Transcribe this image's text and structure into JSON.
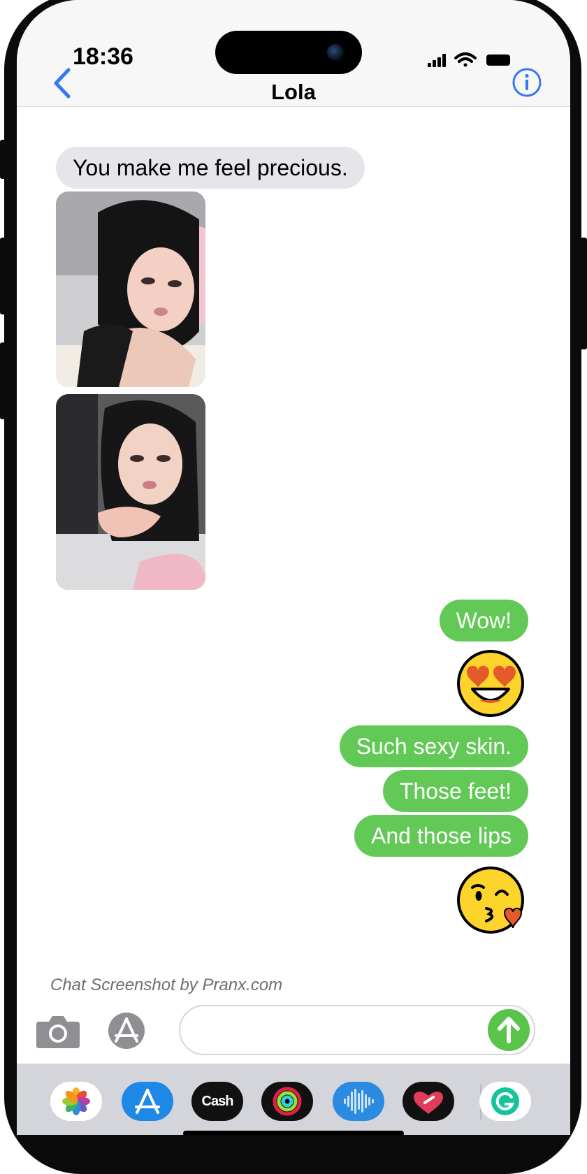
{
  "status_bar": {
    "time": "18:36"
  },
  "header": {
    "contact_name": "Lola"
  },
  "messages": {
    "incoming_1": "You make me feel precious.",
    "outgoing_1": "Wow!",
    "outgoing_2": "Such sexy skin.",
    "outgoing_3": "Those feet!",
    "outgoing_4": "And those lips"
  },
  "emojis": [
    "smiling-face-with-heart-eyes",
    "face-blowing-a-kiss"
  ],
  "watermark": "Chat Screenshot by Pranx.com",
  "compose": {
    "value": "",
    "placeholder": ""
  },
  "dock": {
    "cash_label": "Cash"
  },
  "colors": {
    "outgoing_bubble": "#63c956",
    "incoming_bubble": "#e5e5ea",
    "accent": "#3478f6",
    "send_button": "#58c449"
  }
}
